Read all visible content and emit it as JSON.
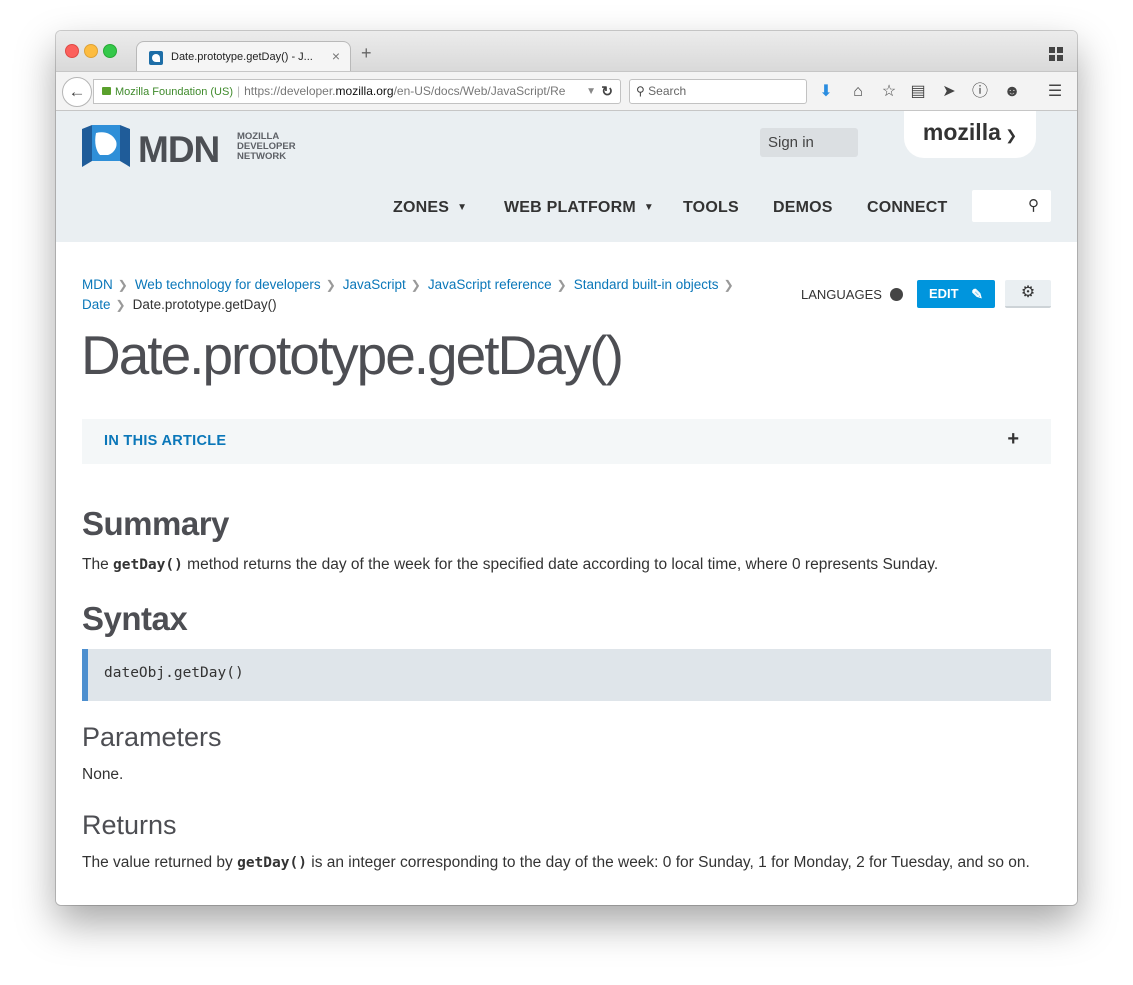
{
  "browser": {
    "tab_title": "Date.prototype.getDay() - J...",
    "tab_close": "×",
    "new_tab": "+",
    "url_org": "Mozilla Foundation (US)",
    "url_prefix": "https://developer.",
    "url_domain": "mozilla.org",
    "url_path": "/en-US/docs/Web/JavaScript/Re",
    "search_placeholder": "Search"
  },
  "header": {
    "logo_text": "MDN",
    "logo_sub": [
      "MOZILLA",
      "DEVELOPER",
      "NETWORK"
    ],
    "sign_in": "Sign in",
    "mozilla": "mozilla",
    "nav": [
      "ZONES",
      "WEB PLATFORM",
      "TOOLS",
      "DEMOS",
      "CONNECT"
    ]
  },
  "breadcrumbs": {
    "items": [
      "MDN",
      "Web technology for developers",
      "JavaScript",
      "JavaScript reference",
      "Standard built-in objects",
      "Date"
    ],
    "current": "Date.prototype.getDay()"
  },
  "actions": {
    "languages": "LANGUAGES",
    "edit": "EDIT"
  },
  "article": {
    "title": "Date.prototype.getDay()",
    "toc_label": "IN THIS ARTICLE",
    "toc_toggle": "+",
    "summary_heading": "Summary",
    "summary_pre": "The ",
    "summary_code": "getDay()",
    "summary_post": " method returns the day of the week for the specified date according to local time, where 0 represents Sunday.",
    "syntax_heading": "Syntax",
    "syntax_code": "dateObj.getDay()",
    "parameters_heading": "Parameters",
    "parameters_text": "None.",
    "returns_heading": "Returns",
    "returns_pre": "The value returned by ",
    "returns_code": "getDay()",
    "returns_post": " is an integer corresponding to the day of the week: 0 for Sunday, 1 for Monday, 2 for Tuesday, and so on."
  },
  "colors": {
    "link": "#0a77b9",
    "edit_button": "#0095dd",
    "header_bg": "#eaeff2",
    "code_border": "#4d8fcf"
  },
  "icons": [
    "back-arrow-icon",
    "lock-icon",
    "reload-icon",
    "search-icon",
    "download-icon",
    "home-icon",
    "bookmark-star-icon",
    "reading-list-icon",
    "send-icon",
    "info-icon",
    "chat-icon",
    "menu-icon",
    "globe-icon",
    "pencil-icon",
    "gear-icon",
    "tabs-grid-icon"
  ]
}
